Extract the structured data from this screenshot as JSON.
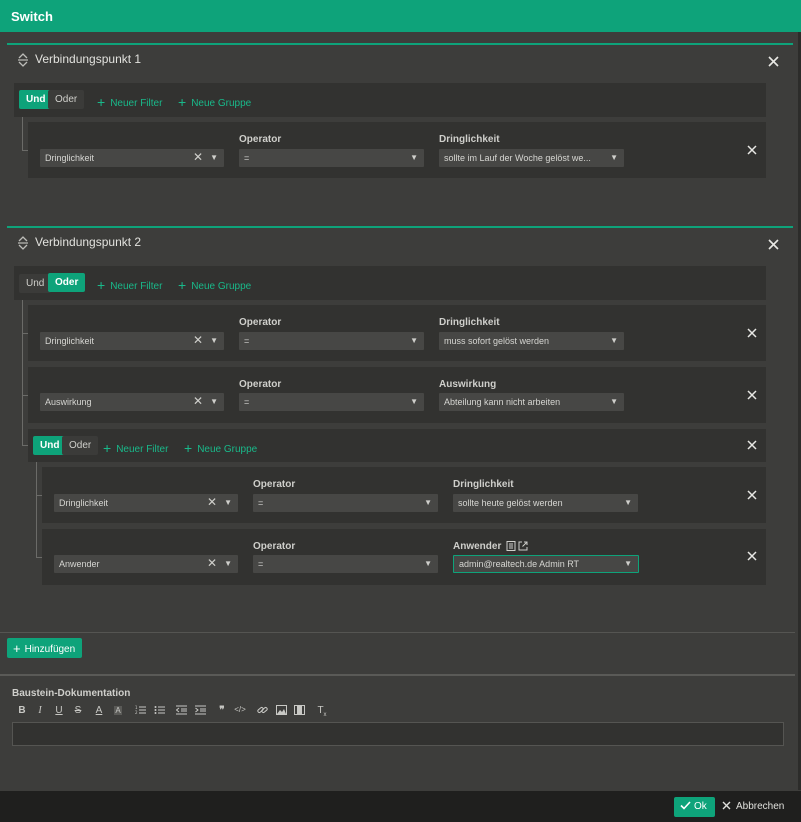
{
  "window": {
    "title": "Switch"
  },
  "connection_points": [
    {
      "title": "Verbindungspunkt 1",
      "logic": {
        "and": "Und",
        "or": "Oder",
        "active": "and"
      },
      "actions": {
        "new_filter": "Neuer Filter",
        "new_group": "Neue Gruppe"
      },
      "filters": [
        {
          "field": "Dringlichkeit",
          "operator_label": "Operator",
          "operator": "=",
          "value_label": "Dringlichkeit",
          "value": "sollte im Lauf der Woche gelöst we..."
        }
      ]
    },
    {
      "title": "Verbindungspunkt 2",
      "logic": {
        "and": "Und",
        "or": "Oder",
        "active": "or"
      },
      "actions": {
        "new_filter": "Neuer Filter",
        "new_group": "Neue Gruppe"
      },
      "filters": [
        {
          "field": "Dringlichkeit",
          "operator_label": "Operator",
          "operator": "=",
          "value_label": "Dringlichkeit",
          "value": "muss sofort gelöst werden"
        },
        {
          "field": "Auswirkung",
          "operator_label": "Operator",
          "operator": "=",
          "value_label": "Auswirkung",
          "value": "Abteilung kann nicht arbeiten"
        }
      ],
      "group": {
        "logic": {
          "and": "Und",
          "or": "Oder",
          "active": "and"
        },
        "actions": {
          "new_filter": "Neuer Filter",
          "new_group": "Neue Gruppe"
        },
        "filters": [
          {
            "field": "Dringlichkeit",
            "operator_label": "Operator",
            "operator": "=",
            "value_label": "Dringlichkeit",
            "value": "sollte heute gelöst werden"
          },
          {
            "field": "Anwender",
            "operator_label": "Operator",
            "operator": "=",
            "value_label": "Anwender",
            "value": "admin@realtech.de Admin RT"
          }
        ]
      }
    }
  ],
  "add_button": "Hinzufügen",
  "documentation": {
    "label": "Baustein-Dokumentation",
    "toolbar": [
      "bold",
      "italic",
      "underline",
      "strikethrough",
      "font-color",
      "background-color",
      "ordered-list",
      "bullet-list",
      "outdent",
      "indent",
      "blockquote",
      "code",
      "link",
      "image",
      "video",
      "clear-format"
    ],
    "content": ""
  },
  "footer": {
    "ok": "Ok",
    "cancel": "Abbrechen"
  },
  "colors": {
    "accent": "#0ea37a",
    "background": "#3d3d3b",
    "panel": "#323230",
    "footer": "#1f1f1e"
  }
}
